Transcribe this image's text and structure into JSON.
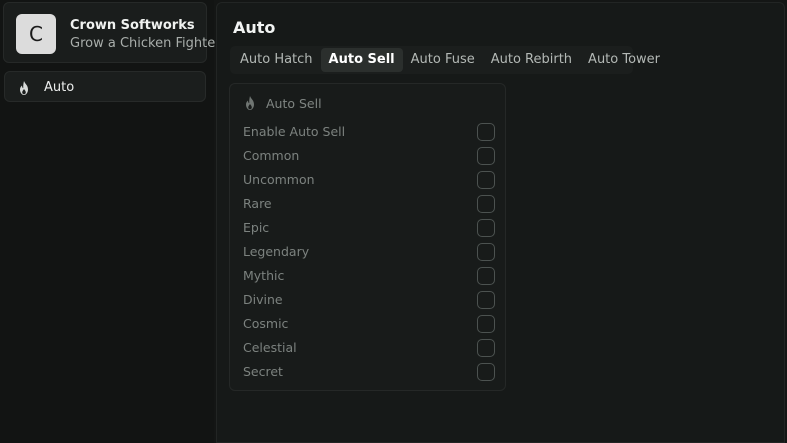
{
  "brand": {
    "avatar_letter": "C",
    "title": "Crown Softworks",
    "subtitle": "Grow a Chicken Fighter"
  },
  "sidebar": {
    "items": [
      {
        "label": "Auto",
        "icon": "flame-icon"
      }
    ]
  },
  "main": {
    "title": "Auto",
    "tabs": [
      {
        "label": "Auto Hatch",
        "active": false
      },
      {
        "label": "Auto Sell",
        "active": true
      },
      {
        "label": "Auto Fuse",
        "active": false
      },
      {
        "label": "Auto Rebirth",
        "active": false
      },
      {
        "label": "Auto Tower",
        "active": false
      }
    ],
    "panel": {
      "title": "Auto Sell",
      "icon": "flame-icon",
      "options": [
        {
          "label": "Enable Auto Sell",
          "checked": false
        },
        {
          "label": "Common",
          "checked": false
        },
        {
          "label": "Uncommon",
          "checked": false
        },
        {
          "label": "Rare",
          "checked": false
        },
        {
          "label": "Epic",
          "checked": false
        },
        {
          "label": "Legendary",
          "checked": false
        },
        {
          "label": "Mythic",
          "checked": false
        },
        {
          "label": "Divine",
          "checked": false
        },
        {
          "label": "Cosmic",
          "checked": false
        },
        {
          "label": "Celestial",
          "checked": false
        },
        {
          "label": "Secret",
          "checked": false
        }
      ]
    }
  },
  "colors": {
    "background": "#141615",
    "panel": "#181b1a",
    "active_tab": "#2b2f2d",
    "muted_text": "#7c827f"
  }
}
